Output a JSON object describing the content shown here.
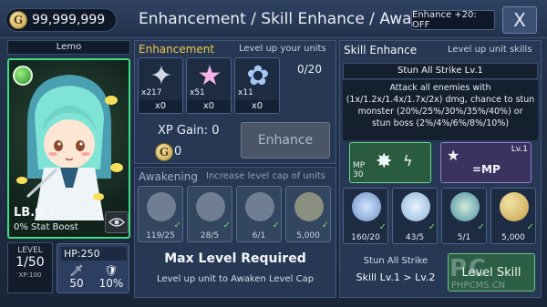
{
  "gold": "99,999,999",
  "title": "Enhancement / Skill Enhance / Awakening",
  "enhance_btn": "Enhance +20: OFF",
  "close_btn": "X",
  "unit": {
    "name": "Lemo",
    "lb": "LB.0/20",
    "stat_boost": "0% Stat Boost",
    "level_label": "LEVEL",
    "level": "1/50",
    "xp": "XP:100",
    "hp": "HP:250",
    "atk": "50",
    "def": "10%"
  },
  "enhancement": {
    "header": "Enhancement",
    "sub": "Level up your units",
    "count": "0/20",
    "materials": [
      {
        "owned": "x217",
        "selected": "x0",
        "icon": "silver-star-icon"
      },
      {
        "owned": "x51",
        "selected": "x0",
        "icon": "rainbow-star-icon"
      },
      {
        "owned": "x11",
        "selected": "x0",
        "icon": "fairy-icon"
      }
    ],
    "xp_gain": "XP Gain: 0",
    "cost": "0",
    "btn": "Enhance"
  },
  "awakening": {
    "header": "Awakening",
    "sub": "Increase level cap of units",
    "items": [
      {
        "num": "119/25",
        "icon": "wing-icon"
      },
      {
        "num": "28/5",
        "icon": "disc-icon"
      },
      {
        "num": "6/1",
        "icon": "laurel-icon"
      },
      {
        "num": "5,000",
        "icon": "gold-coin-icon"
      }
    ],
    "max": "Max Level Required",
    "hint": "Level up unit to Awaken Level Cap"
  },
  "skill": {
    "header": "Skill Enhance",
    "sub": "Level up unit skills",
    "name": "Stun All Strike Lv.1",
    "desc_lines": [
      "Attack all enemies with",
      "(1x/1.2x/1.4x/1.7x/2x) dmg, chance to stun",
      "monster (20%/25%/30%/35%/40%) or",
      "stun boss (2%/4%/6%/8%/10%)"
    ],
    "mp_label": "MP",
    "mp_value": "30",
    "lv_label": "Lv.1",
    "mp_arrow": "=MP",
    "mats": [
      {
        "num": "160/20",
        "icon": "crescent-moon-icon"
      },
      {
        "num": "43/5",
        "icon": "moon-orb-icon"
      },
      {
        "num": "5/1",
        "icon": "ghost-icon"
      },
      {
        "num": "5,000",
        "icon": "gold-coin-icon"
      }
    ],
    "stun_label": "Stun All Strike",
    "level_change": "Skill Lv.1 > Lv.2",
    "level_btn": "Level Skill"
  },
  "watermark": {
    "big": "PC",
    "small": "PHPCMS.CN"
  },
  "colors": {
    "accent": "#f2c94c",
    "green": "#3ddc84"
  }
}
